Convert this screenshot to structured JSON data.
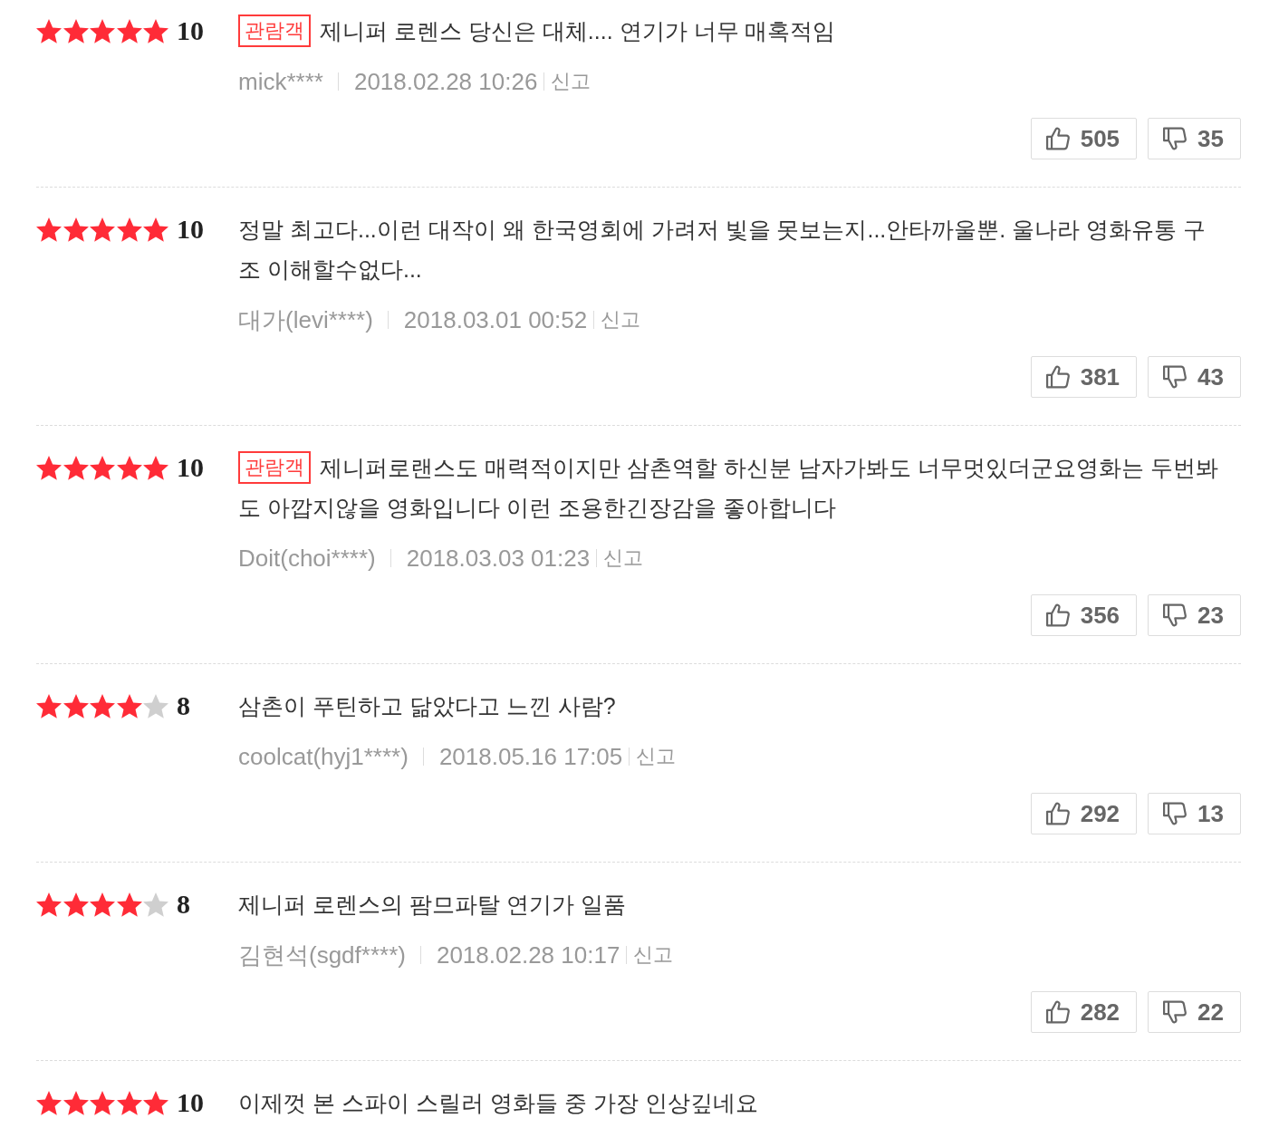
{
  "reviews": [
    {
      "stars": 5,
      "score": "10",
      "badge": "관람객",
      "comment": "제니퍼 로렌스 당신은 대체.... 연기가 너무 매혹적임",
      "author": "mick****",
      "date": "2018.02.28 10:26",
      "report": "신고",
      "likes": "505",
      "dislikes": "35"
    },
    {
      "stars": 5,
      "score": "10",
      "comment": "정말 최고다...이런 대작이 왜 한국영회에 가려저 빛을 못보는지...안타까울뿐. 울나라 영화유통 구조 이해할수없다...",
      "author": "대가(levi****)",
      "date": "2018.03.01 00:52",
      "report": "신고",
      "likes": "381",
      "dislikes": "43"
    },
    {
      "stars": 5,
      "score": "10",
      "badge": "관람객",
      "comment": "제니퍼로랜스도 매력적이지만 삼촌역할 하신분 남자가봐도 너무멋있더군요영화는 두번봐도 아깝지않을 영화입니다 이런 조용한긴장감을 좋아합니다",
      "author": "Doit(choi****)",
      "date": "2018.03.03 01:23",
      "report": "신고",
      "likes": "356",
      "dislikes": "23"
    },
    {
      "stars": 4,
      "score": "8",
      "comment": "삼촌이 푸틴하고 닮았다고 느낀 사람?",
      "author": "coolcat(hyj1****)",
      "date": "2018.05.16 17:05",
      "report": "신고",
      "likes": "292",
      "dislikes": "13"
    },
    {
      "stars": 4,
      "score": "8",
      "comment": "제니퍼 로렌스의 팜므파탈 연기가 일품",
      "author": "김현석(sgdf****)",
      "date": "2018.02.28 10:17",
      "report": "신고",
      "likes": "282",
      "dislikes": "22"
    },
    {
      "stars": 5,
      "score": "10",
      "comment": "이제껏 본 스파이 스릴러 영화들 중 가장 인상깊네요"
    }
  ]
}
